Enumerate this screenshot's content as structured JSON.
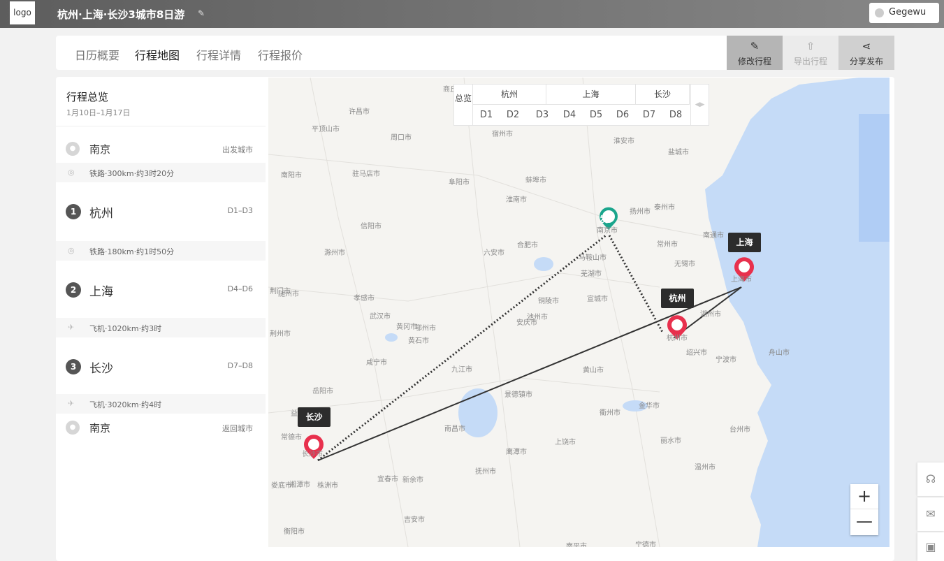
{
  "header": {
    "logo": "logo",
    "trip_title": "杭州·上海·长沙3城市8日游",
    "user_name": "Gegewu"
  },
  "tabs": [
    {
      "label": "日历概要"
    },
    {
      "label": "行程地图"
    },
    {
      "label": "行程详情"
    },
    {
      "label": "行程报价"
    }
  ],
  "actions": [
    {
      "label": "修改行程"
    },
    {
      "label": "导出行程"
    },
    {
      "label": "分享发布"
    }
  ],
  "overview": {
    "title": "行程总览",
    "dates": "1月10日–1月17日",
    "start": {
      "city": "南京",
      "meta": "出发城市"
    },
    "legs": [
      {
        "text": "铁路·300km·约3时20分"
      },
      {
        "text": "铁路·180km·约1时50分"
      },
      {
        "text": "飞机·1020km·约3时"
      },
      {
        "text": "飞机·3020km·约4时"
      }
    ],
    "stops": [
      {
        "num": "1",
        "city": "杭州",
        "days": "D1–D3"
      },
      {
        "num": "2",
        "city": "上海",
        "days": "D4–D6"
      },
      {
        "num": "3",
        "city": "长沙",
        "days": "D7–D8"
      }
    ],
    "end": {
      "city": "南京",
      "meta": "返回城市"
    }
  },
  "daybar": {
    "overview_label": "总览",
    "cities": [
      "杭州",
      "上海",
      "长沙"
    ],
    "days": [
      "D1",
      "D2",
      "D3",
      "D4",
      "D5",
      "D6",
      "D7",
      "D8"
    ]
  },
  "map": {
    "start_marker": "发",
    "tags": {
      "shanghai": "上海",
      "hangzhou": "杭州",
      "changsha": "长沙"
    },
    "labels": [
      "商丘市",
      "许昌市",
      "周口市",
      "宿州市",
      "平顶山市",
      "淮安市",
      "盐城市",
      "驻马店市",
      "蚌埠市",
      "阜阳市",
      "扬州市",
      "泰州市",
      "淮南市",
      "南阳市",
      "信阳市",
      "合肥市",
      "滁州市",
      "南通市",
      "六安市",
      "南京市",
      "常州市",
      "无锡市",
      "随州市",
      "马鞍山市",
      "芜湖市",
      "上海市",
      "孝感市",
      "荆门市",
      "铜陵市",
      "宣城市",
      "湖州市",
      "武汉市",
      "安庆市",
      "池州市",
      "杭州市",
      "黄冈市",
      "鄂州市",
      "黄石市",
      "绍兴市",
      "宁波市",
      "咸宁市",
      "九江市",
      "黄山市",
      "荆州市",
      "岳阳市",
      "景德镇市",
      "衢州市",
      "金华市",
      "舟山市",
      "益阳市",
      "南昌市",
      "鹰潭市",
      "上饶市",
      "台州市",
      "丽水市",
      "常德市",
      "长沙市",
      "抚州市",
      "温州市",
      "湘潭市",
      "株洲市",
      "宜春市",
      "新余市",
      "娄底市",
      "吉安市",
      "衡阳市",
      "南平市",
      "宁德市"
    ],
    "zoom_in": "+",
    "zoom_out": "—"
  },
  "colors": {
    "pin": "#e8304d",
    "start_pin": "#1aa58c",
    "sea": "#c5dbf7"
  }
}
